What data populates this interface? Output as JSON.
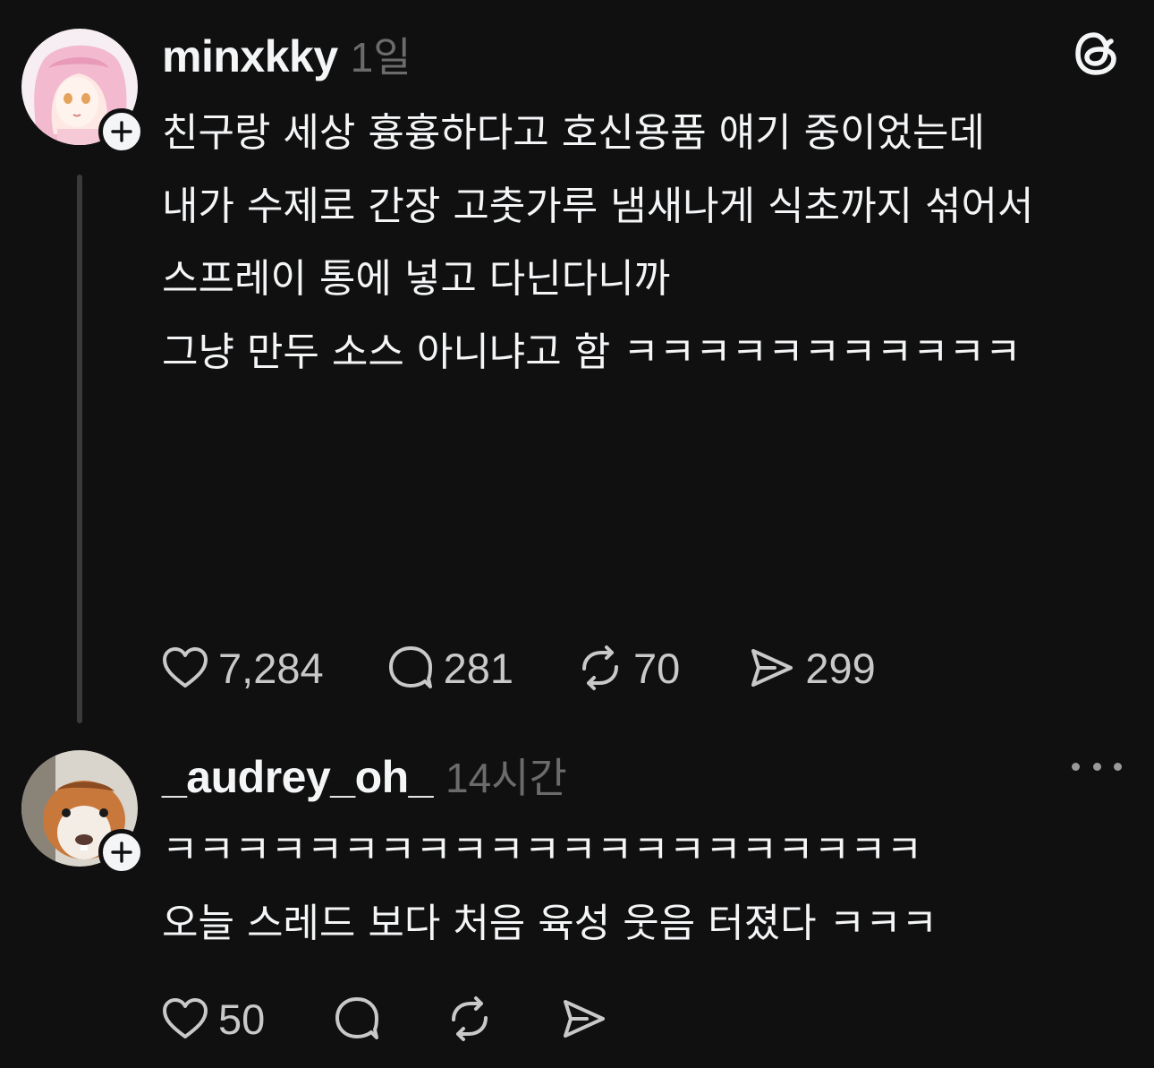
{
  "posts": [
    {
      "username": "minxkky",
      "time": "1일",
      "text": "친구랑 세상 흉흉하다고 호신용품 얘기 중이었는데\n내가 수제로 간장 고춧가루 냄새나게 식초까지 섞어서\n스프레이 통에 넣고 다닌다니까\n그냥 만두 소스 아니냐고 함 ㅋㅋㅋㅋㅋㅋㅋㅋㅋㅋㅋ",
      "likes": "7,284",
      "replies": "281",
      "reposts": "70",
      "shares": "299"
    },
    {
      "username": "_audrey_oh_",
      "time": "14시간",
      "text": "ㅋㅋㅋㅋㅋㅋㅋㅋㅋㅋㅋㅋㅋㅋㅋㅋㅋㅋㅋㅋㅋ\n오늘 스레드 보다 처음 육성 웃음 터졌다 ㅋㅋㅋ",
      "likes": "50"
    }
  ],
  "icons": {
    "threads_logo": "threads-logo-icon",
    "like": "heart-icon",
    "reply": "comment-icon",
    "repost": "repost-icon",
    "share": "send-icon",
    "more": "more-horizontal-icon",
    "follow": "plus-icon"
  },
  "colors": {
    "background": "#101010",
    "text": "#f3f5f7",
    "muted": "#6b6b6b",
    "thread_line": "#3a3a3a"
  }
}
